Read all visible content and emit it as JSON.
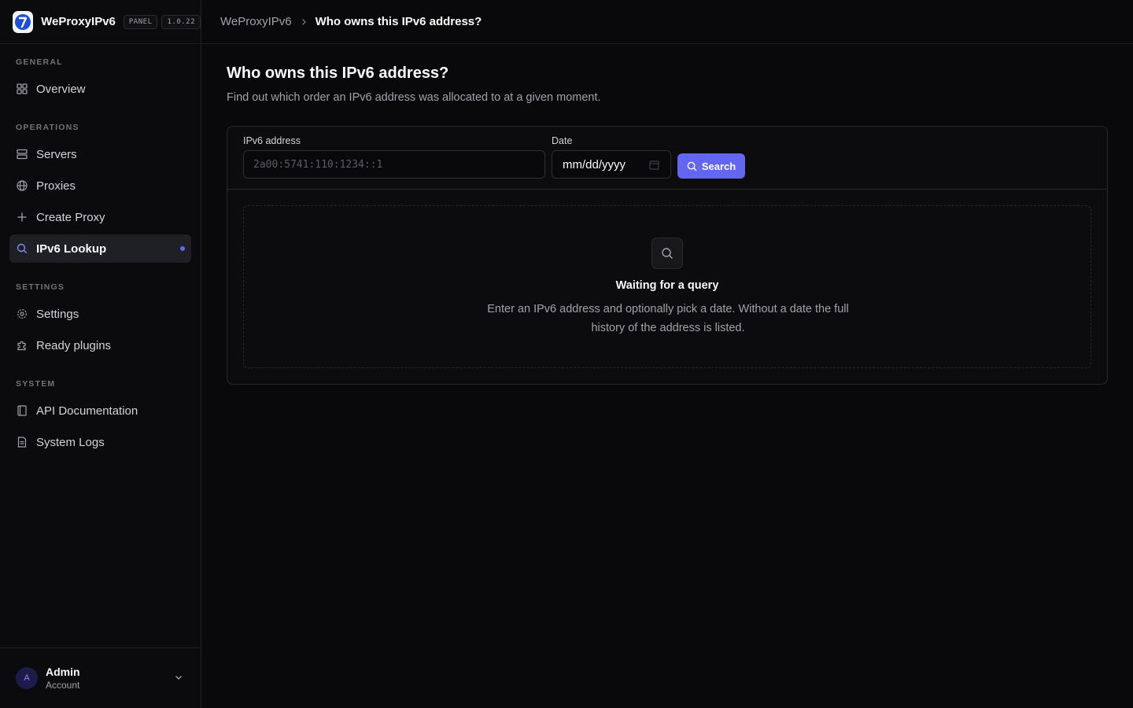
{
  "brand": {
    "name": "WeProxyIPv6",
    "badge_panel": "PANEL",
    "badge_version": "1.0.22"
  },
  "sidebar": {
    "sections": [
      {
        "title": "GENERAL",
        "items": [
          {
            "label": "Overview",
            "icon": "grid-icon"
          }
        ]
      },
      {
        "title": "OPERATIONS",
        "items": [
          {
            "label": "Servers",
            "icon": "server-icon"
          },
          {
            "label": "Proxies",
            "icon": "globe-icon"
          },
          {
            "label": "Create Proxy",
            "icon": "plus-icon"
          },
          {
            "label": "IPv6 Lookup",
            "icon": "search-icon",
            "active": true
          }
        ]
      },
      {
        "title": "SETTINGS",
        "items": [
          {
            "label": "Settings",
            "icon": "gear-icon"
          },
          {
            "label": "Ready plugins",
            "icon": "puzzle-icon"
          }
        ]
      },
      {
        "title": "SYSTEM",
        "items": [
          {
            "label": "API Documentation",
            "icon": "book-icon"
          },
          {
            "label": "System Logs",
            "icon": "file-icon"
          }
        ]
      }
    ],
    "account": {
      "initial": "A",
      "name": "Admin",
      "subtitle": "Account"
    }
  },
  "breadcrumb": {
    "root": "WeProxyIPv6",
    "current": "Who owns this IPv6 address?"
  },
  "page": {
    "title": "Who owns this IPv6 address?",
    "subtitle": "Find out which order an IPv6 address was allocated to at a given moment."
  },
  "form": {
    "ipv6_label": "IPv6 address",
    "ipv6_placeholder": "2a00:5741:110:1234::1",
    "date_label": "Date",
    "date_placeholder": "mm/dd/yyyy",
    "search_label": "Search"
  },
  "empty_state": {
    "title": "Waiting for a query",
    "text": "Enter an IPv6 address and optionally pick a date. Without a date the full history of the address is listed."
  },
  "colors": {
    "accent": "#6366f1",
    "background": "#09090b",
    "sidebar": "#0b0b0e",
    "border": "#27272a"
  }
}
